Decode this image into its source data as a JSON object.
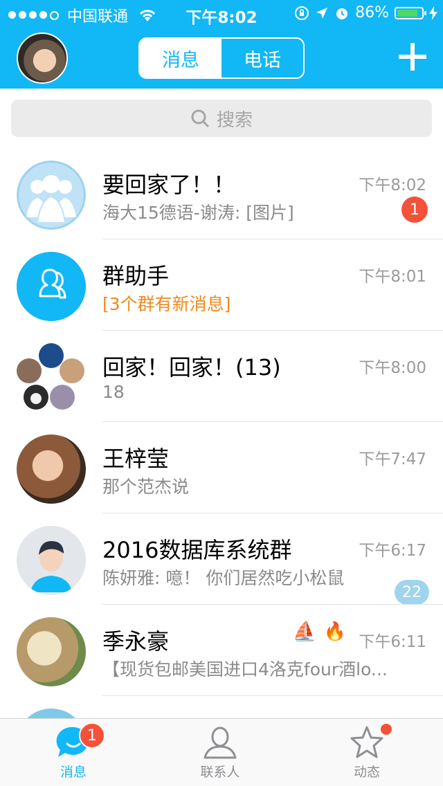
{
  "status_bar": {
    "carrier": "中国联通",
    "time": "下午8:02",
    "battery": "86%",
    "battery_level": 0.86
  },
  "header": {
    "tabs": [
      {
        "label": "消息",
        "active": true
      },
      {
        "label": "电话",
        "active": false
      }
    ],
    "add_icon": "plus-icon",
    "avatar_icon": "profile-photo"
  },
  "search": {
    "placeholder": "搜索"
  },
  "conversations": [
    {
      "name": "要回家了！！",
      "message": "海大15德语-谢涛: [图片]",
      "time": "下午8:02",
      "badge": "1"
    },
    {
      "name": "群助手",
      "message": "[3个群有新消息]",
      "time": "下午8:01"
    },
    {
      "name": "回家！回家！(13)",
      "message": "18",
      "time": "下午8:00"
    },
    {
      "name": "王梓莹",
      "message": "那个范杰说",
      "time": "下午7:47"
    },
    {
      "name": "2016数据库系统群",
      "message": "陈妍雅: 噫！ 你们居然吃小松鼠",
      "time": "下午6:17",
      "badge": "22"
    },
    {
      "name": "季永豪",
      "message": "【现货包邮美国进口4洛克four酒lo...",
      "time": "下午6:11",
      "emojis": [
        "⛵",
        "🔥"
      ]
    }
  ],
  "tabbar": {
    "items": [
      {
        "label": "消息",
        "icon": "chat-bubble-icon",
        "badge": "1"
      },
      {
        "label": "联系人",
        "icon": "contact-person-icon"
      },
      {
        "label": "动态",
        "icon": "star-icon"
      }
    ]
  },
  "colors": {
    "brand": "#12b7f5",
    "badge_red": "#f4513a",
    "badge_blue": "#9fd4ef",
    "highlight_orange": "#ef8a1e"
  }
}
